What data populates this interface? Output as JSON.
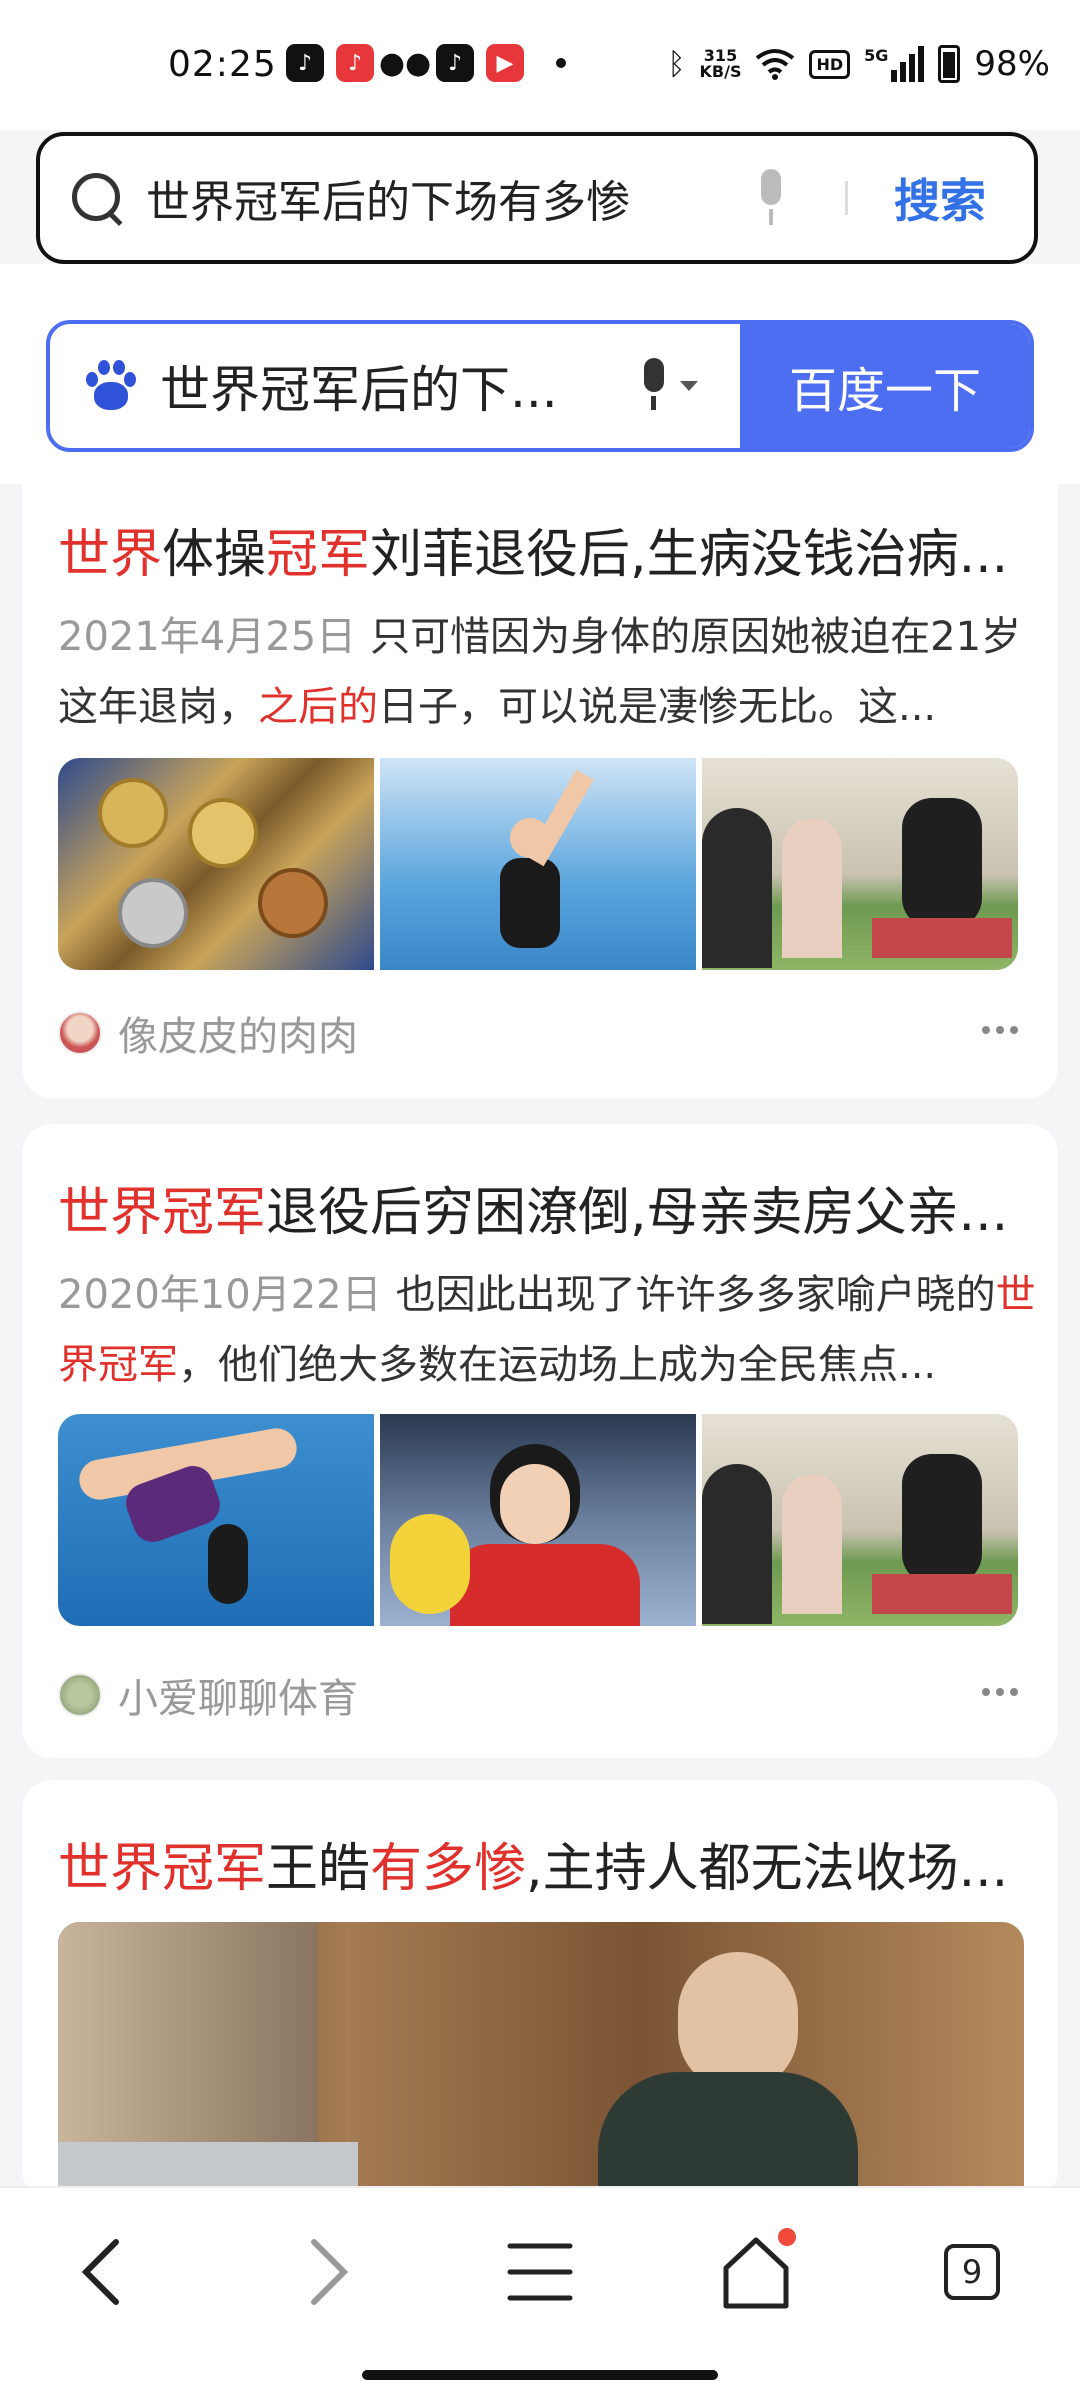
{
  "status": {
    "time": "02:25",
    "net_speed": "315",
    "net_unit": "KB/S",
    "hd": "HD",
    "signal_gen": "5G",
    "battery": "98%"
  },
  "top_search": {
    "query": "世界冠军后的下场有多惨",
    "button": "搜索"
  },
  "baidu": {
    "query": "世界冠军后的下...",
    "button": "百度一下"
  },
  "results": [
    {
      "title": [
        {
          "t": "世界",
          "hl": true
        },
        {
          "t": "体操",
          "hl": false
        },
        {
          "t": "冠军",
          "hl": true
        },
        {
          "t": "刘菲退役后,生病没钱治病...",
          "hl": false
        }
      ],
      "date": "2021年4月25日",
      "snippet": [
        {
          "t": "只可惜因为身体的原因她被迫在21岁这年退岗，",
          "hl": false
        },
        {
          "t": "之后的",
          "hl": true
        },
        {
          "t": "日子，可以说是凄惨无比。这...",
          "hl": false
        }
      ],
      "thumbs": [
        "medals-photo",
        "gymnast-photo",
        "family-room-photo"
      ],
      "source": "像皮皮的肉肉"
    },
    {
      "title": [
        {
          "t": "世界冠军",
          "hl": true
        },
        {
          "t": "退役后穷困潦倒,母亲卖房父亲...",
          "hl": false
        }
      ],
      "date": "2020年10月22日",
      "snippet": [
        {
          "t": "也因此出现了许许多多家喻户晓的",
          "hl": false
        },
        {
          "t": "世界冠军",
          "hl": true
        },
        {
          "t": "，他们绝大多数在运动场上成为全民焦点...",
          "hl": false
        }
      ],
      "thumbs": [
        "diver-photo",
        "swimmer-photo",
        "family-room-photo"
      ],
      "source": "小爱聊聊体育"
    },
    {
      "title": [
        {
          "t": "世界冠军",
          "hl": true
        },
        {
          "t": "王皓",
          "hl": false
        },
        {
          "t": "有多惨",
          "hl": true
        },
        {
          "t": ",主持人都无法收场...",
          "hl": false
        }
      ]
    }
  ],
  "nav": {
    "tabs_count": "9"
  },
  "colors": {
    "highlight": "#e0312c",
    "baidu_blue": "#4e6ef2",
    "link_blue": "#3371e6"
  }
}
